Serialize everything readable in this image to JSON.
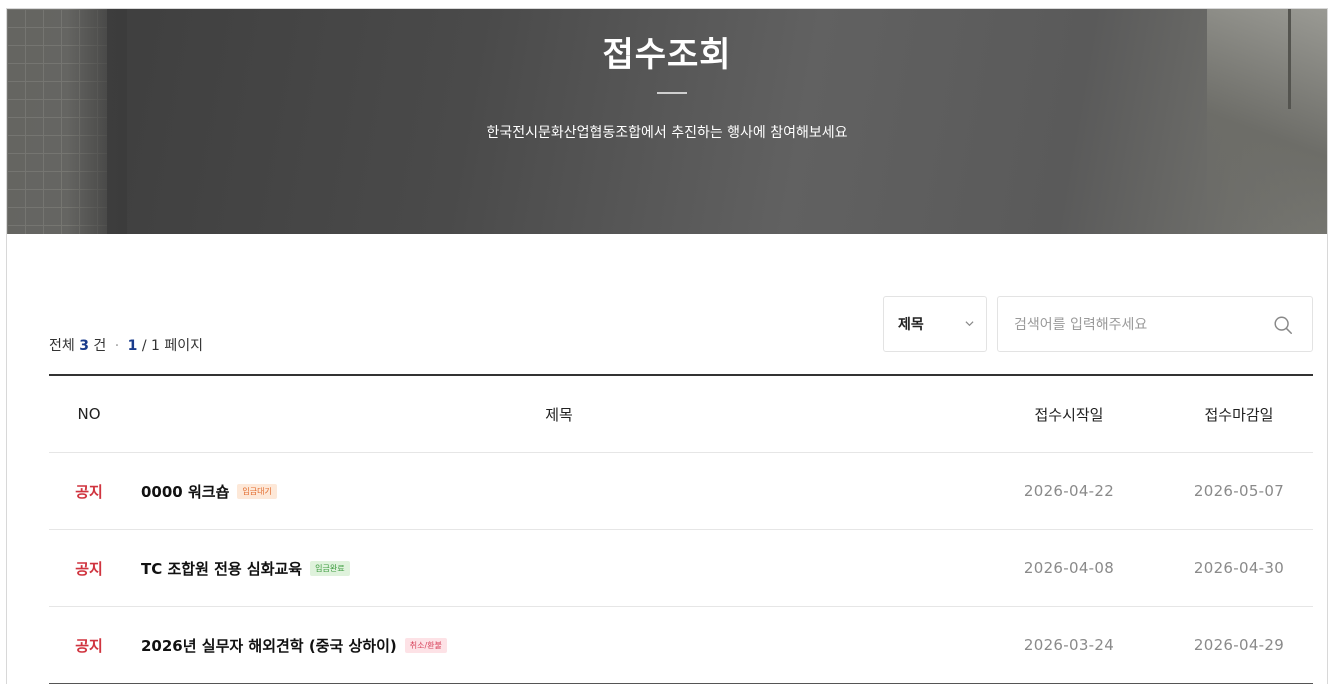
{
  "hero": {
    "title": "접수조회",
    "subtitle": "한국전시문화산업협동조합에서 추진하는 행사에 참여해보세요"
  },
  "summary": {
    "total_label": "전체",
    "total_count": "3",
    "count_unit": "건",
    "separator": "·",
    "current_page": "1",
    "page_divider": "/",
    "total_pages": "1",
    "page_unit": "페이지"
  },
  "search": {
    "field_selected": "제목",
    "placeholder": "검색어를 입력해주세요"
  },
  "table": {
    "columns": {
      "no": "NO",
      "title": "제목",
      "start": "접수시작일",
      "end": "접수마감일"
    },
    "rows": [
      {
        "no": "공지",
        "title": "0000 워크숍",
        "badge": "입금대기",
        "start": "2026-04-22",
        "end": "2026-05-07"
      },
      {
        "no": "공지",
        "title": "TC 조합원 전용 심화교육",
        "badge": "입금완료",
        "start": "2026-04-08",
        "end": "2026-04-30"
      },
      {
        "no": "공지",
        "title": "2026년 실무자 해외견학 (중국 상하이)",
        "badge": "취소/환불",
        "start": "2026-03-24",
        "end": "2026-04-29"
      }
    ]
  },
  "colors": {
    "notice": "#d0343f",
    "count_accent": "#1a3c8c",
    "badge_wait": "#e26a2c",
    "badge_done": "#3a9a3c",
    "badge_cancel": "#d7425a"
  },
  "icons": {
    "select": "chevron-down-icon",
    "search": "search-icon"
  }
}
